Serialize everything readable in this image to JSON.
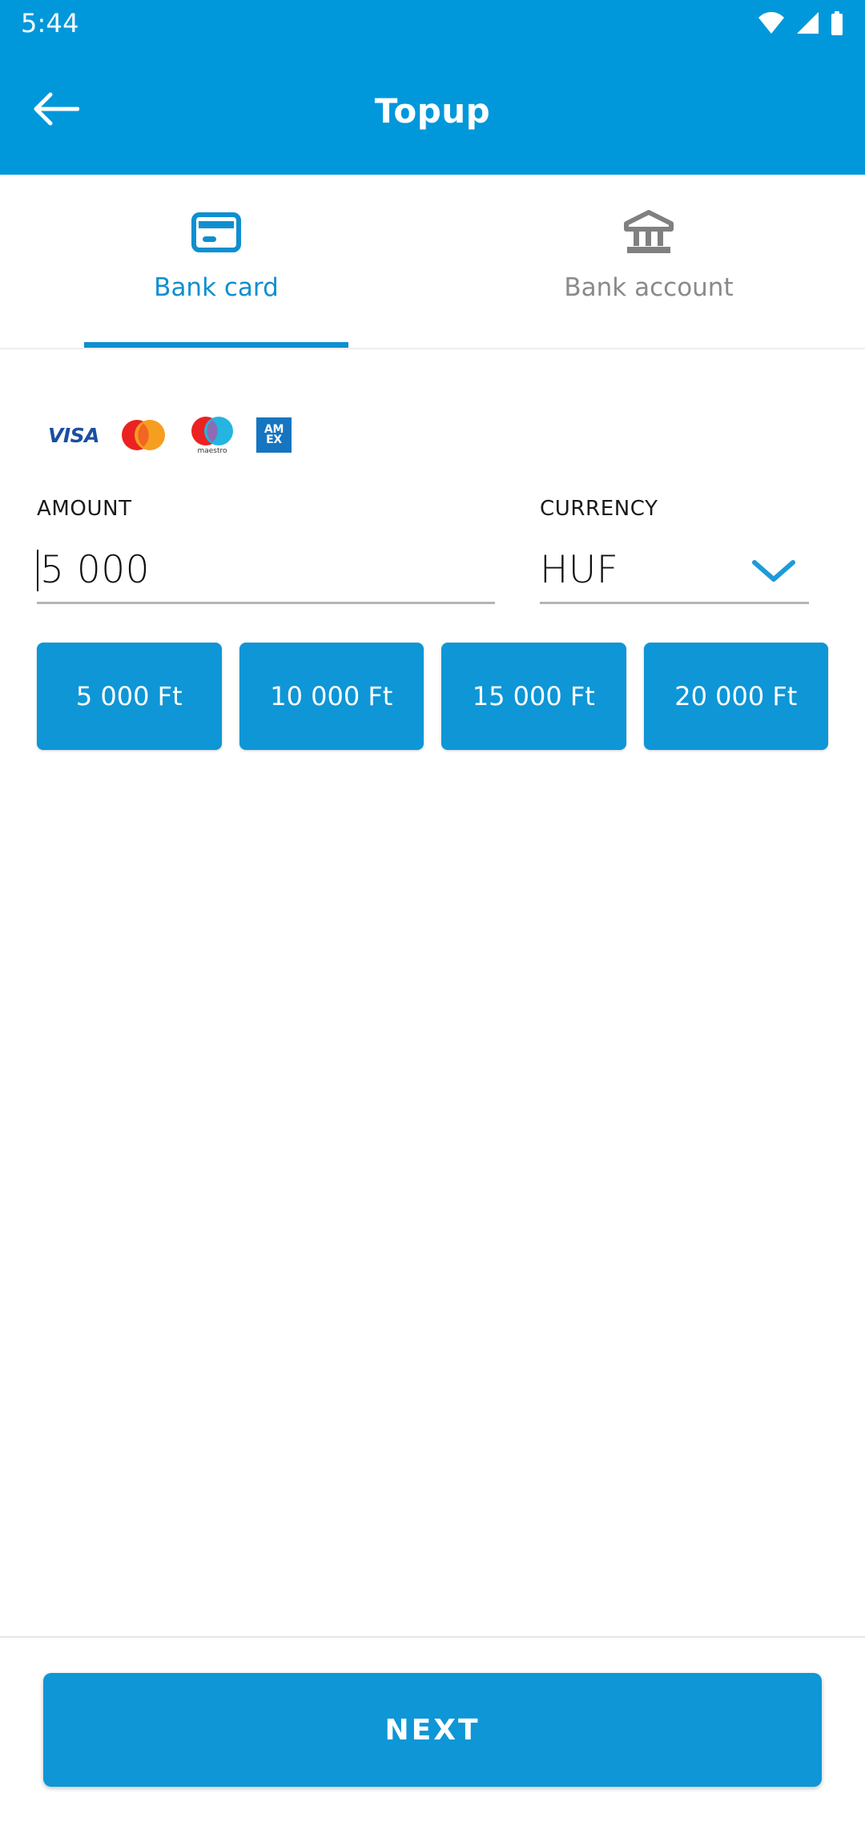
{
  "status_bar": {
    "time": "5:44",
    "icons": [
      "wifi-icon",
      "cellular-signal-icon",
      "battery-icon"
    ]
  },
  "app_bar": {
    "title": "Topup",
    "back_icon": "arrow-left-icon"
  },
  "tabs": [
    {
      "label": "Bank card",
      "icon": "credit-card-icon",
      "active": true
    },
    {
      "label": "Bank account",
      "icon": "bank-icon",
      "active": false
    }
  ],
  "card_brands": [
    {
      "name": "visa",
      "label": "VISA"
    },
    {
      "name": "mastercard",
      "label": ""
    },
    {
      "name": "maestro",
      "label": "maestro"
    },
    {
      "name": "amex",
      "label_top": "AM",
      "label_bottom": "EX"
    }
  ],
  "amount_field": {
    "label": "AMOUNT",
    "value": "5 000",
    "placeholder": "0"
  },
  "currency_field": {
    "label": "CURRENCY",
    "value": "HUF",
    "chevron_icon": "chevron-down-icon",
    "options": [
      "HUF"
    ]
  },
  "quick_amounts": [
    {
      "label": "5 000 Ft"
    },
    {
      "label": "10 000 Ft"
    },
    {
      "label": "15 000 Ft"
    },
    {
      "label": "20 000 Ft"
    }
  ],
  "bottom_bar": {
    "next_label": "NEXT"
  },
  "colors": {
    "primary": "#0098DB",
    "accent": "#0E96D6",
    "tab_active": "#0E8FD0",
    "tab_inactive": "#8a8a8a",
    "underline": "#b5b5b5",
    "visa_blue": "#1A4EA2",
    "amex_blue": "#1675C0"
  }
}
